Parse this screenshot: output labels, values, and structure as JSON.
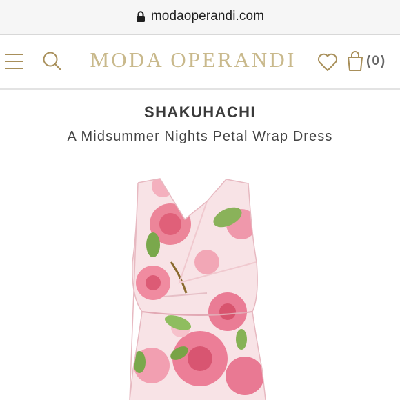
{
  "browser": {
    "url": "modaoperandi.com",
    "icons": {
      "lock": "lock-icon"
    }
  },
  "header": {
    "brand": "MODA OPERANDI",
    "bag_count": "(0)",
    "brand_color": "#c9b98c",
    "icons": {
      "menu": "hamburger-menu-icon",
      "search": "search-icon",
      "wishlist": "heart-icon",
      "bag": "shopping-bag-icon"
    }
  },
  "product": {
    "designer": "SHAKUHACHI",
    "name": "A Midsummer Nights Petal Wrap Dress",
    "image": {
      "depicts": "sleeveless floral wrap dress",
      "palette": [
        "#f7dde1",
        "#ec7f97",
        "#7aa84c"
      ]
    }
  }
}
